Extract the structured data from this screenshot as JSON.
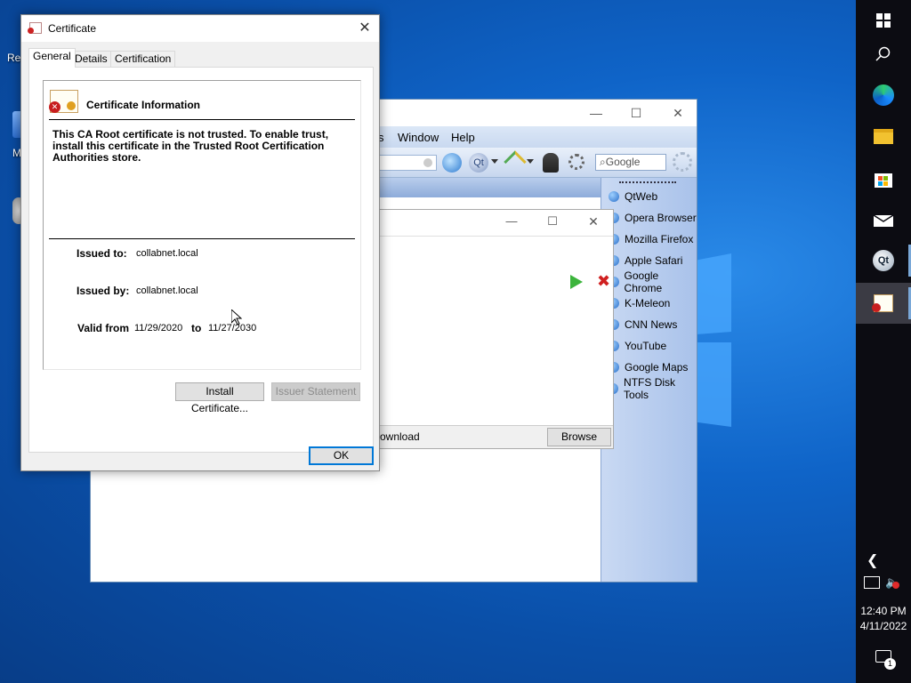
{
  "desktop": {
    "icon_labels": [
      "Re",
      "M"
    ]
  },
  "browser": {
    "menus": [
      "s",
      "Window",
      "Help"
    ],
    "search_placeholder": "Google",
    "bookmarks": [
      "QtWeb",
      "Opera Browser",
      "Mozilla Firefox",
      "Apple Safari",
      "Google Chrome",
      "K-Meleon",
      "CNN News",
      "YouTube",
      "Google Maps",
      "NTFS Disk Tools"
    ]
  },
  "download_dialog": {
    "bottom_label": "ownload",
    "browse_label": "Browse"
  },
  "certificate": {
    "title": "Certificate",
    "tabs": [
      "General",
      "Details",
      "Certification Path"
    ],
    "header": "Certificate Information",
    "warning": "This CA Root certificate is not trusted. To enable trust, install this certificate in the Trusted Root Certification Authorities store.",
    "issued_to_label": "Issued to:",
    "issued_to": "collabnet.local",
    "issued_by_label": "Issued by:",
    "issued_by": "collabnet.local",
    "valid_from_label": "Valid from",
    "valid_from": "11/29/2020",
    "to_label": "to",
    "valid_to": "11/27/2030",
    "install_button": "Install Certificate...",
    "issuer_button": "Issuer Statement",
    "ok_button": "OK"
  },
  "taskbar": {
    "time": "12:40 PM",
    "date": "4/11/2022",
    "notification_count": "1"
  }
}
